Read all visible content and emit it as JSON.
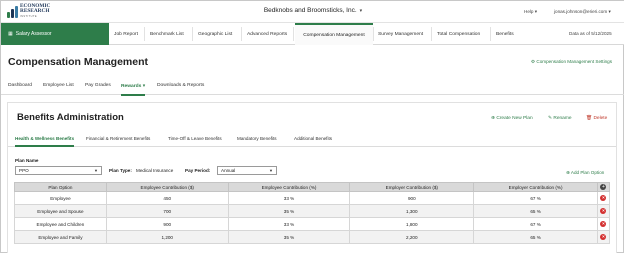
{
  "brand": {
    "line1": "ECONOMIC",
    "line2": "RESEARCH",
    "tagline": "INSTITUTE"
  },
  "header": {
    "company": "Bedknobs and Broomsticks, Inc.",
    "help": "Help",
    "user": "jonas.johnson@erieri.com"
  },
  "nav": {
    "app_button": "Salary Assessor",
    "items": [
      "Job Report",
      "Benchmark List",
      "Geographic List",
      "Advanced Reports",
      "Compensation Management",
      "Survey Management",
      "Total Compensation",
      "Benefits"
    ],
    "active": "Compensation Management",
    "date_of_data": "Data as of 5/12/2025"
  },
  "page": {
    "title": "Compensation Management",
    "settings_link": "Compensation Management Settings"
  },
  "subnav": {
    "items": [
      "Dashboard",
      "Employee List",
      "Pay Grades",
      "Rewards",
      "Downloads & Reports"
    ],
    "active": "Rewards"
  },
  "panel": {
    "title": "Benefits Administration",
    "actions": {
      "create": "Create New Plan",
      "rename": "Rename",
      "delete": "Delete"
    },
    "tabs": [
      "Health & Wellness Benefits",
      "Financial & Retirement Benefits",
      "Time-Off & Leave Benefits",
      "Mandatory Benefits",
      "Additional Benefits"
    ],
    "active_tab": "Health & Wellness Benefits",
    "plan_name_label": "Plan Name",
    "plan_name_value": "PPO",
    "plan_type_label": "Plan Type:",
    "plan_type_value": "Medical Insurance",
    "pay_period_label": "Pay Period:",
    "pay_period_value": "Annual",
    "add_option": "Add Plan Option"
  },
  "table": {
    "headers": [
      "Plan Option",
      "Employee Contribution ($)",
      "Employee Contribution (%)",
      "Employer Contribution ($)",
      "Employer Contribution (%)"
    ],
    "rows": [
      [
        "Employee",
        "450",
        "33 %",
        "900",
        "67 %"
      ],
      [
        "Employee and Spouse",
        "700",
        "35 %",
        "1,300",
        "65 %"
      ],
      [
        "Employee and Children",
        "900",
        "33 %",
        "1,800",
        "67 %"
      ],
      [
        "Employee and Family",
        "1,200",
        "35 %",
        "2,200",
        "65 %"
      ]
    ]
  },
  "icons": {
    "grid": "grid-icon",
    "caret": "caret-down-icon",
    "gear": "gear-icon",
    "plus": "plus-circle-icon",
    "pencil": "pencil-icon",
    "trash": "trash-icon",
    "remove": "remove-circle-icon"
  },
  "colors": {
    "brand_green": "#2e7d4a",
    "delete_red": "#d32f2f",
    "table_header": "#d9d9d9"
  }
}
